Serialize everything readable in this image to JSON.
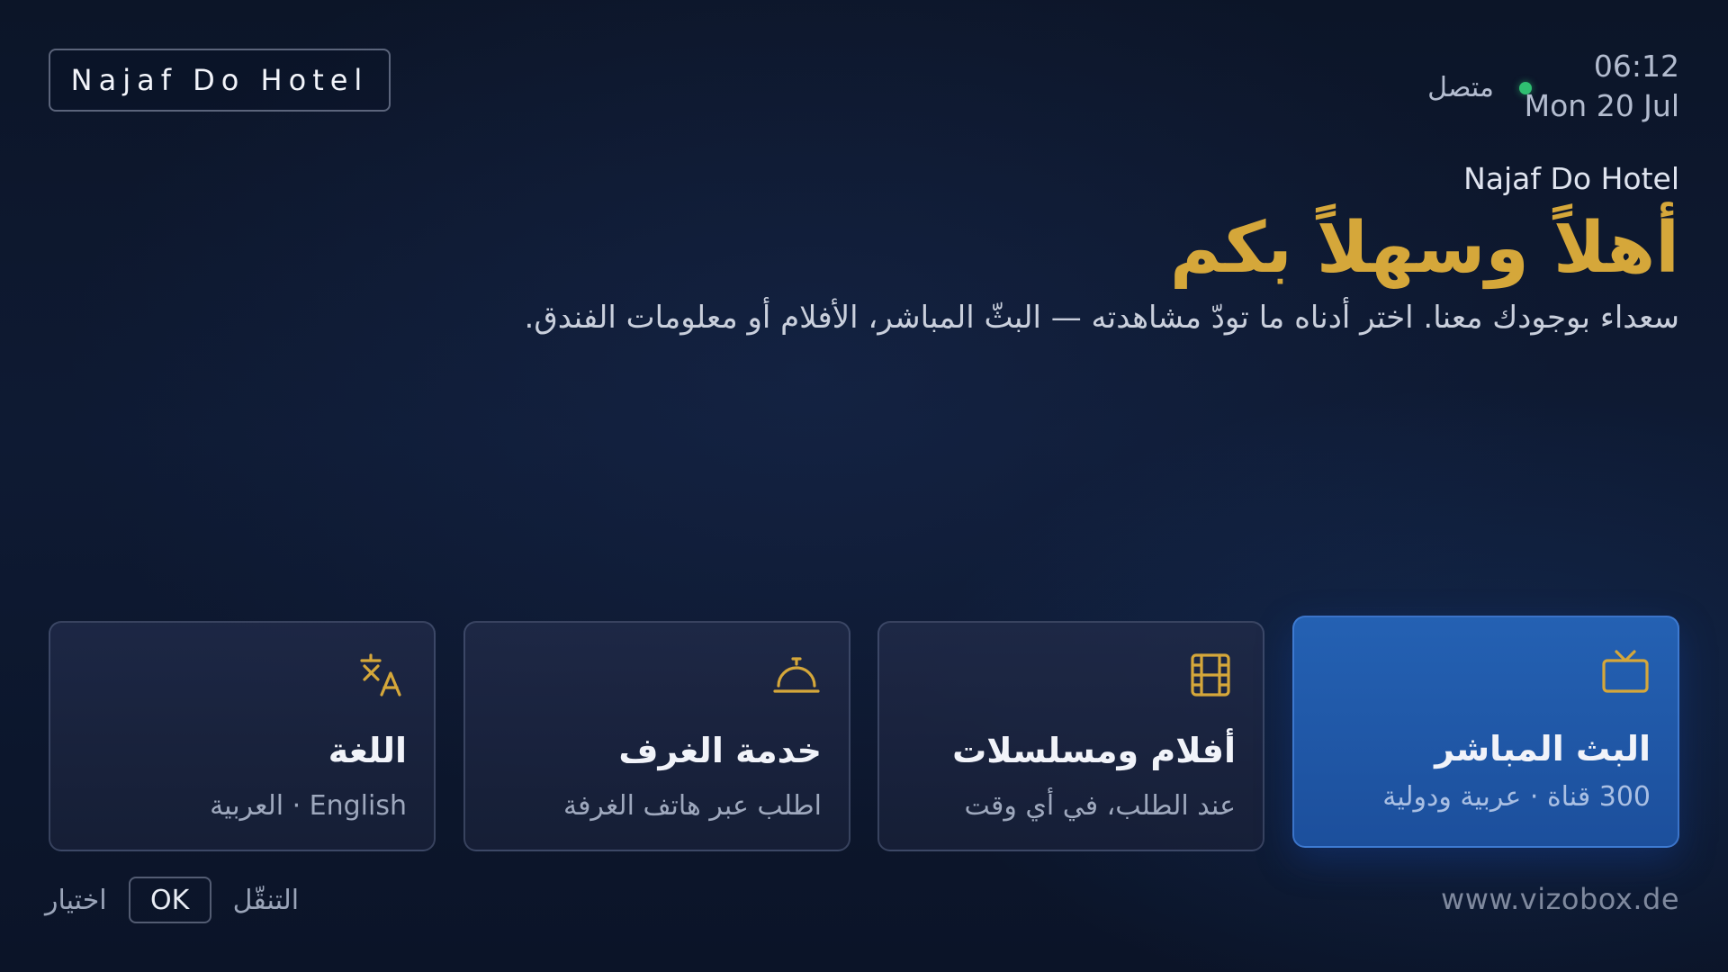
{
  "header": {
    "logo_text": "Najaf Do Hotel",
    "time": "06:12",
    "date": "Mon 20 Jul",
    "status_label": "متصل",
    "status_color": "#2fbf71"
  },
  "hero": {
    "hotel_name": "Najaf Do Hotel",
    "welcome": "أهلاً وسهلاً بكم",
    "subtitle": "سعداء بوجودك معنا. اختر أدناه ما تودّ مشاهدته — البثّ المباشر، الأفلام أو معلومات الفندق."
  },
  "cards": [
    {
      "title": "البث المباشر",
      "desc": "300 قناة · عربية ودولية",
      "icon": "tv-icon",
      "active": true
    },
    {
      "title": "أفلام ومسلسلات",
      "desc": "عند الطلب، في أي وقت",
      "icon": "film-icon",
      "active": false
    },
    {
      "title": "خدمة الغرف",
      "desc": "اطلب عبر هاتف الغرفة",
      "icon": "service-bell-icon",
      "active": false
    },
    {
      "title": "اللغة",
      "desc": "English · العربية",
      "icon": "translate-icon",
      "active": false
    }
  ],
  "footer": {
    "navigate_label": "التنقّل",
    "ok_label": "OK",
    "select_label": "اختيار",
    "website": "www.vizobox.de"
  },
  "colors": {
    "accent_gold": "#d5a73a",
    "active_card": "#2461b3",
    "background": "#0e1a33"
  }
}
